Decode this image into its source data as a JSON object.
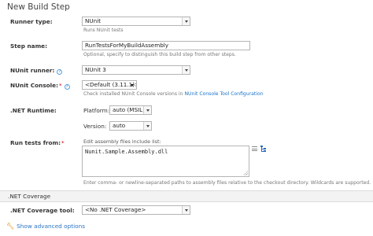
{
  "page": {
    "title": "New Build Step"
  },
  "runner_type": {
    "label": "Runner type:",
    "value": "NUnit",
    "hint": "Runs NUnit tests"
  },
  "step_name": {
    "label": "Step name:",
    "value": "RunTestsForMyBuildAssembly",
    "hint": "Optional, specify to distinguish this build step from other steps."
  },
  "nunit_runner": {
    "label": "NUnit runner:",
    "value": "NUnit 3"
  },
  "nunit_console": {
    "label": "NUnit Console:",
    "required_mark": "*",
    "value": "<Default (3.11.1)>",
    "hint_prefix": "Check installed NUnit Console versions in ",
    "hint_link": "NUnit Console Tool Configuration"
  },
  "net_runtime": {
    "label": ".NET Runtime:",
    "platform_label": "Platform:",
    "platform_value": "auto (MSIL)",
    "version_label": "Version:",
    "version_value": "auto"
  },
  "run_tests_from": {
    "label": "Run tests from:",
    "required_mark": "*",
    "top_hint": "Edit assembly files include list:",
    "value": "Nunit.Sample.Assembly.dll",
    "hint": "Enter comma- or newline-separated paths to assembly files relative to the checkout directory. Wildcards are supported."
  },
  "net_coverage": {
    "section_title": ".NET Coverage",
    "label": ".NET Coverage tool:",
    "value": "<No .NET Coverage>"
  },
  "advanced": {
    "label": "Show advanced options",
    "icon": "wrench-icon"
  },
  "colors": {
    "link": "#1a73c8",
    "required": "#cc0000",
    "section_bg": "#f3f3f3"
  }
}
